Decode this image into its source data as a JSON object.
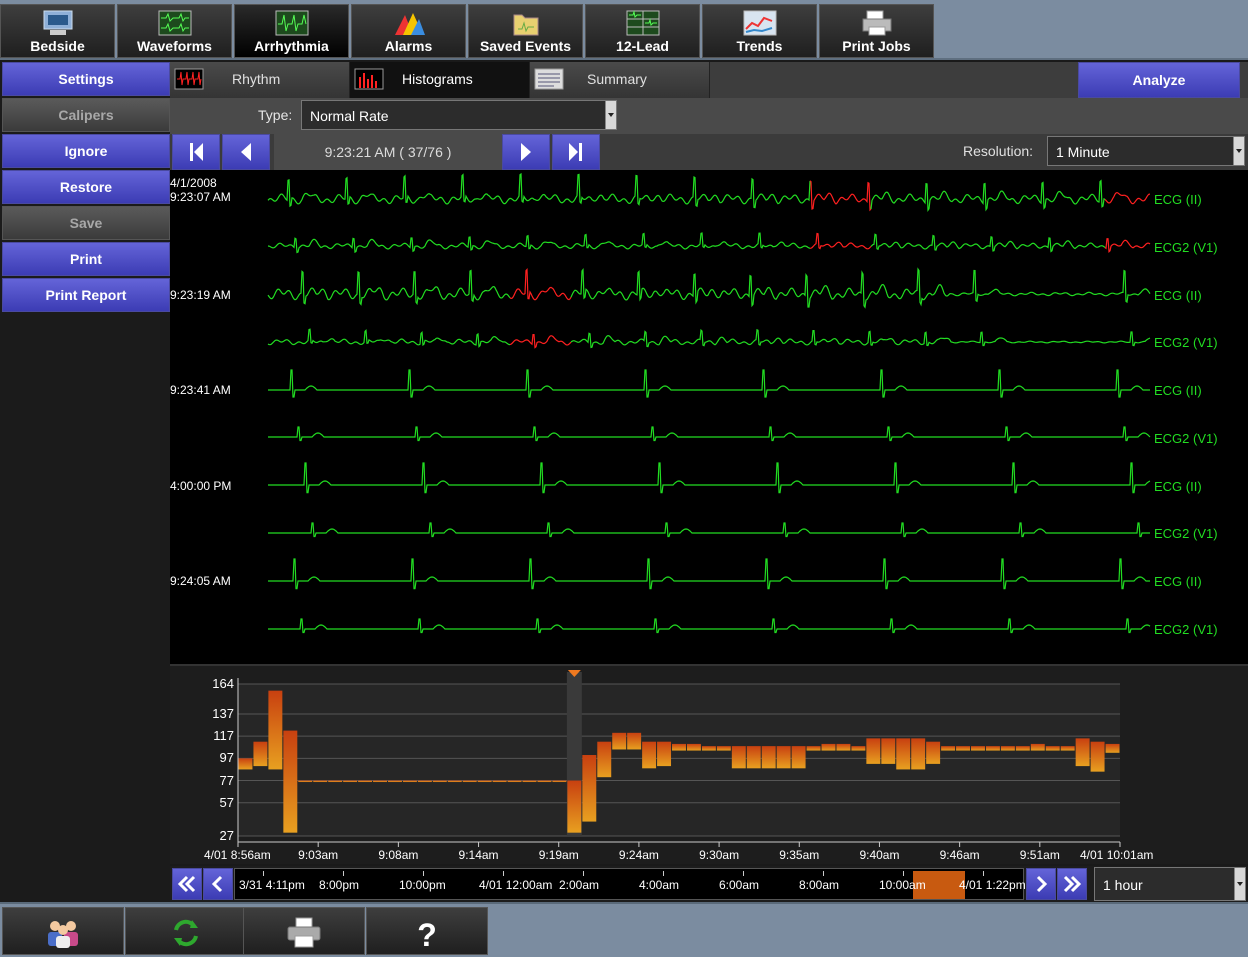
{
  "top_tabs": [
    {
      "label": "Bedside",
      "icon": "bedside-monitor-icon"
    },
    {
      "label": "Waveforms",
      "icon": "waveforms-icon"
    },
    {
      "label": "Arrhythmia",
      "icon": "arrhythmia-icon",
      "active": true
    },
    {
      "label": "Alarms",
      "icon": "alarms-icon"
    },
    {
      "label": "Saved Events",
      "icon": "saved-events-icon"
    },
    {
      "label": "12-Lead",
      "icon": "twelve-lead-icon"
    },
    {
      "label": "Trends",
      "icon": "trends-icon"
    },
    {
      "label": "Print Jobs",
      "icon": "print-jobs-icon"
    }
  ],
  "left_menu": [
    {
      "label": "Settings",
      "enabled": true
    },
    {
      "label": "Calipers",
      "enabled": false
    },
    {
      "label": "Ignore",
      "enabled": true
    },
    {
      "label": "Restore",
      "enabled": true
    },
    {
      "label": "Save",
      "enabled": false
    },
    {
      "label": "Print",
      "enabled": true
    },
    {
      "label": "Print Report",
      "enabled": true
    }
  ],
  "sub_tabs": [
    {
      "label": "Rhythm",
      "icon": "rhythm-icon"
    },
    {
      "label": "Histograms",
      "icon": "histograms-icon",
      "active": true
    },
    {
      "label": "Summary",
      "icon": "summary-icon"
    }
  ],
  "analyze_label": "Analyze",
  "type": {
    "label": "Type:",
    "value": "Normal Rate"
  },
  "navigation": {
    "time": "9:23:21 AM  ( 37/76 )",
    "resolution_label": "Resolution:",
    "resolution_value": "1 Minute"
  },
  "ecg_strips": [
    {
      "date": "4/1/2008",
      "time": "9:23:07 AM",
      "leads": [
        "ECG (II)",
        "ECG2 (V1)"
      ]
    },
    {
      "date": "",
      "time": "9:23:19 AM",
      "leads": [
        "ECG (II)",
        "ECG2 (V1)"
      ]
    },
    {
      "date": "",
      "time": "9:23:41 AM",
      "leads": [
        "ECG (II)",
        "ECG2 (V1)"
      ]
    },
    {
      "date": "",
      "time": "4:00:00 PM",
      "leads": [
        "ECG (II)",
        "ECG2 (V1)"
      ]
    },
    {
      "date": "",
      "time": "9:24:05 AM",
      "leads": [
        "ECG (II)",
        "ECG2 (V1)"
      ]
    }
  ],
  "colors": {
    "waveform": "#22dd22",
    "abnormal": "#ff2020",
    "accent": "#4c4cc8",
    "bar": "#d26a1a"
  },
  "chart_data": {
    "type": "bar",
    "title": "",
    "xlabel": "",
    "ylabel": "",
    "ylim": [
      27,
      164
    ],
    "y_ticks": [
      164,
      137,
      117,
      97,
      77,
      57,
      27
    ],
    "x_ticks": [
      "4/01 8:56am",
      "9:03am",
      "9:08am",
      "9:14am",
      "9:19am",
      "9:24am",
      "9:30am",
      "9:35am",
      "9:40am",
      "9:46am",
      "9:51am",
      "4/01 10:01am"
    ],
    "series": [
      {
        "values": [
          [
            97,
            87
          ],
          [
            112,
            90
          ],
          [
            158,
            87
          ],
          [
            122,
            30
          ],
          [
            77,
            77
          ],
          [
            77,
            77
          ],
          [
            77,
            77
          ],
          [
            77,
            77
          ],
          [
            77,
            77
          ],
          [
            77,
            77
          ],
          [
            77,
            77
          ],
          [
            77,
            77
          ],
          [
            77,
            77
          ],
          [
            77,
            77
          ],
          [
            77,
            77
          ],
          [
            77,
            77
          ],
          [
            77,
            77
          ],
          [
            77,
            77
          ],
          [
            77,
            76
          ],
          [
            77,
            77
          ],
          [
            77,
            77
          ],
          [
            77,
            77
          ],
          [
            77,
            30
          ],
          [
            100,
            40
          ],
          [
            112,
            80
          ],
          [
            120,
            105
          ],
          [
            120,
            105
          ],
          [
            112,
            88
          ],
          [
            112,
            90
          ],
          [
            110,
            104
          ],
          [
            110,
            104
          ],
          [
            108,
            104
          ],
          [
            108,
            104
          ],
          [
            108,
            88
          ],
          [
            108,
            88
          ],
          [
            108,
            88
          ],
          [
            108,
            88
          ],
          [
            108,
            88
          ],
          [
            108,
            104
          ],
          [
            110,
            104
          ],
          [
            110,
            104
          ],
          [
            108,
            104
          ],
          [
            115,
            92
          ],
          [
            115,
            92
          ],
          [
            115,
            87
          ],
          [
            115,
            87
          ],
          [
            112,
            92
          ],
          [
            108,
            104
          ],
          [
            108,
            104
          ],
          [
            108,
            104
          ],
          [
            108,
            104
          ],
          [
            108,
            104
          ],
          [
            108,
            104
          ],
          [
            110,
            104
          ],
          [
            108,
            104
          ],
          [
            108,
            104
          ],
          [
            115,
            90
          ],
          [
            112,
            85
          ],
          [
            110,
            102
          ]
        ]
      }
    ]
  },
  "range_bar": {
    "labels": [
      "3/31 4:11pm",
      "8:00pm",
      "10:00pm",
      "4/01 12:00am",
      "2:00am",
      "4:00am",
      "6:00am",
      "8:00am",
      "10:00am",
      "4/01 1:22pm"
    ],
    "selected": "1 hour"
  },
  "bottom_buttons": [
    {
      "icon": "patients-icon"
    },
    {
      "icon": "refresh-icon"
    },
    {
      "icon": "printer-icon"
    },
    {
      "icon": "help-icon"
    }
  ]
}
